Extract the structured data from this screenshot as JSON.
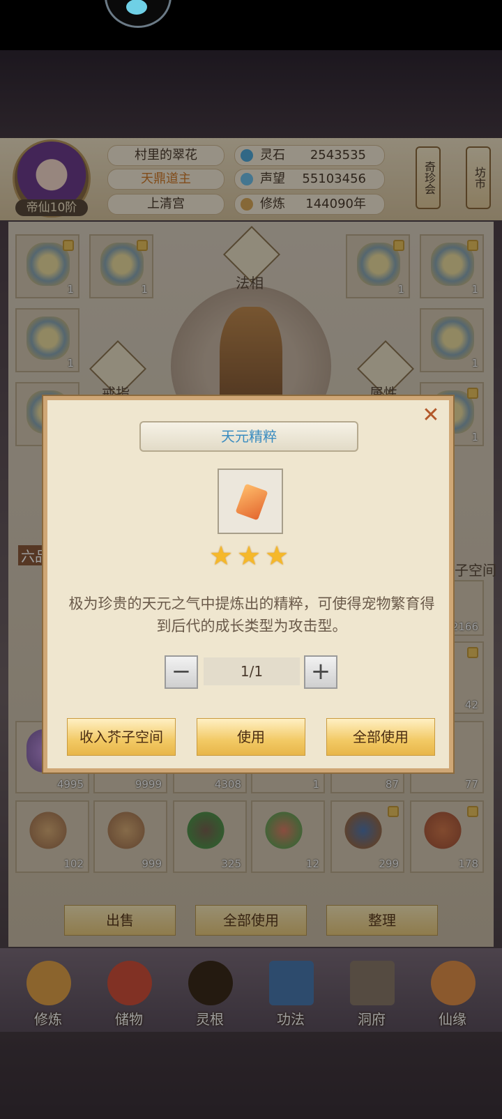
{
  "player": {
    "name": "村里的翠花",
    "title": "天鼎道主",
    "sect": "上清宫",
    "rank": "帝仙10阶"
  },
  "stats": [
    {
      "label": "灵石",
      "value": "2543535",
      "icon": "spirit-stone-icon"
    },
    {
      "label": "声望",
      "value": "55103456",
      "icon": "reputation-icon"
    },
    {
      "label": "修炼",
      "value": "144090年",
      "icon": "cultivation-icon"
    }
  ],
  "side_buttons": {
    "treasure_fair": "奇珍会",
    "market": "坊市"
  },
  "equipment": {
    "dharma_label": "法相",
    "ring_label": "戒指",
    "attribute_label": "属性",
    "slot_counts": [
      "1",
      "1",
      "1",
      "1",
      "1",
      "1",
      "1",
      "1"
    ]
  },
  "bag": {
    "grade_tab": "六品",
    "space_label": "子空间",
    "row_counts_a": [
      "4995",
      "9999",
      "4308",
      "1",
      "87",
      "77"
    ],
    "row_counts_b": [
      "102",
      "999",
      "325",
      "12",
      "299",
      "178"
    ],
    "right_counts": [
      "2166",
      "42"
    ]
  },
  "toolbar": {
    "sell": "出售",
    "use_all": "全部使用",
    "arrange": "整理"
  },
  "nav": [
    {
      "label": "修炼",
      "icon": "cultivate-icon"
    },
    {
      "label": "储物",
      "icon": "storage-bag-icon"
    },
    {
      "label": "灵根",
      "icon": "spirit-root-icon"
    },
    {
      "label": "功法",
      "icon": "technique-book-icon"
    },
    {
      "label": "洞府",
      "icon": "cave-dwelling-icon"
    },
    {
      "label": "仙缘",
      "icon": "immortal-fate-icon"
    }
  ],
  "modal": {
    "title": "天元精粹",
    "stars": 3,
    "description": "极为珍贵的天元之气中提炼出的精粹，可使得宠物繁育得到后代的成长类型为攻击型。",
    "quantity": "1/1",
    "buttons": {
      "store": "收入芥子空间",
      "use": "使用",
      "use_all": "全部使用"
    }
  }
}
